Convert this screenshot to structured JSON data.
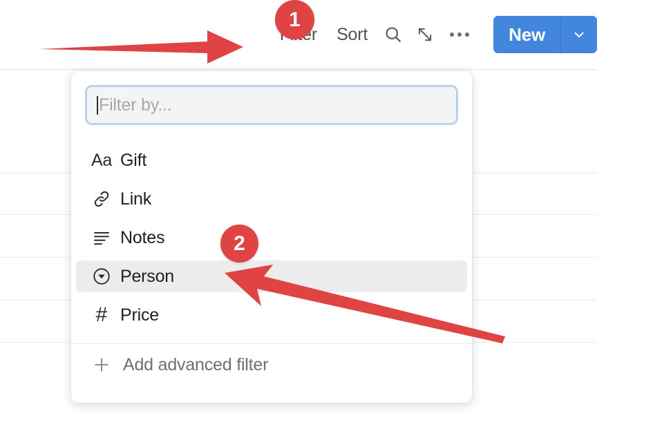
{
  "toolbar": {
    "filter_label": "Filter",
    "sort_label": "Sort",
    "search_icon": "search-icon",
    "expand_icon": "expand-diagonal-icon",
    "overflow_icon": "more-horizontal-icon",
    "new_label": "New",
    "new_caret_icon": "chevron-down-icon",
    "new_button_color": "#4287dd"
  },
  "filter_popup": {
    "input": {
      "value": "",
      "placeholder": "Filter by...",
      "focused": true
    },
    "options": [
      {
        "label": "Gift",
        "icon": "text-aa-icon",
        "highlighted": false
      },
      {
        "label": "Link",
        "icon": "link-chain-icon",
        "highlighted": false
      },
      {
        "label": "Notes",
        "icon": "text-lines-icon",
        "highlighted": false
      },
      {
        "label": "Person",
        "icon": "select-circle-icon",
        "highlighted": true
      },
      {
        "label": "Price",
        "icon": "hash-number-icon",
        "highlighted": false
      }
    ],
    "advanced": {
      "label": "Add advanced filter",
      "icon": "plus-icon"
    },
    "highlight_color": "#ececec"
  },
  "annotations": {
    "accent_color": "#e04343",
    "badges": [
      {
        "number": "1"
      },
      {
        "number": "2"
      }
    ],
    "arrows": [
      {
        "name": "arrow-to-filter",
        "direction": "right"
      },
      {
        "name": "arrow-to-person",
        "direction": "upper-left"
      }
    ]
  },
  "table": {
    "row_line_color": "#ececec",
    "row_line_positions": [
      0,
      150,
      210,
      272,
      334,
      395
    ]
  }
}
